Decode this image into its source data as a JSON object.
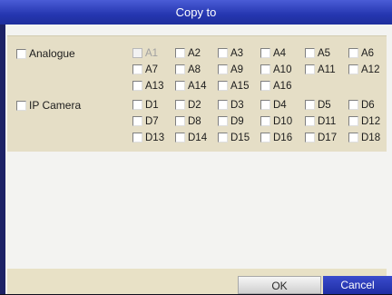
{
  "dialog": {
    "title": "Copy to",
    "analogue": {
      "label": "Analogue",
      "channels": [
        {
          "label": "A1",
          "enabled": false
        },
        {
          "label": "A2",
          "enabled": true
        },
        {
          "label": "A3",
          "enabled": true
        },
        {
          "label": "A4",
          "enabled": true
        },
        {
          "label": "A5",
          "enabled": true
        },
        {
          "label": "A6",
          "enabled": true
        },
        {
          "label": "A7",
          "enabled": true
        },
        {
          "label": "A8",
          "enabled": true
        },
        {
          "label": "A9",
          "enabled": true
        },
        {
          "label": "A10",
          "enabled": true
        },
        {
          "label": "A11",
          "enabled": true
        },
        {
          "label": "A12",
          "enabled": true
        },
        {
          "label": "A13",
          "enabled": true
        },
        {
          "label": "A14",
          "enabled": true
        },
        {
          "label": "A15",
          "enabled": true
        },
        {
          "label": "A16",
          "enabled": true
        }
      ]
    },
    "ip_camera": {
      "label": "IP Camera",
      "channels": [
        {
          "label": "D1",
          "enabled": true
        },
        {
          "label": "D2",
          "enabled": true
        },
        {
          "label": "D3",
          "enabled": true
        },
        {
          "label": "D4",
          "enabled": true
        },
        {
          "label": "D5",
          "enabled": true
        },
        {
          "label": "D6",
          "enabled": true
        },
        {
          "label": "D7",
          "enabled": true
        },
        {
          "label": "D8",
          "enabled": true
        },
        {
          "label": "D9",
          "enabled": true
        },
        {
          "label": "D10",
          "enabled": true
        },
        {
          "label": "D11",
          "enabled": true
        },
        {
          "label": "D12",
          "enabled": true
        },
        {
          "label": "D13",
          "enabled": true
        },
        {
          "label": "D14",
          "enabled": true
        },
        {
          "label": "D15",
          "enabled": true
        },
        {
          "label": "D16",
          "enabled": true
        },
        {
          "label": "D17",
          "enabled": true
        },
        {
          "label": "D18",
          "enabled": true
        }
      ]
    },
    "buttons": {
      "ok": "OK",
      "cancel": "Cancel"
    },
    "colors": {
      "title_bar": "#2536b0",
      "panel": "#e5dec6",
      "cancel_button": "#1f2ea4"
    }
  }
}
